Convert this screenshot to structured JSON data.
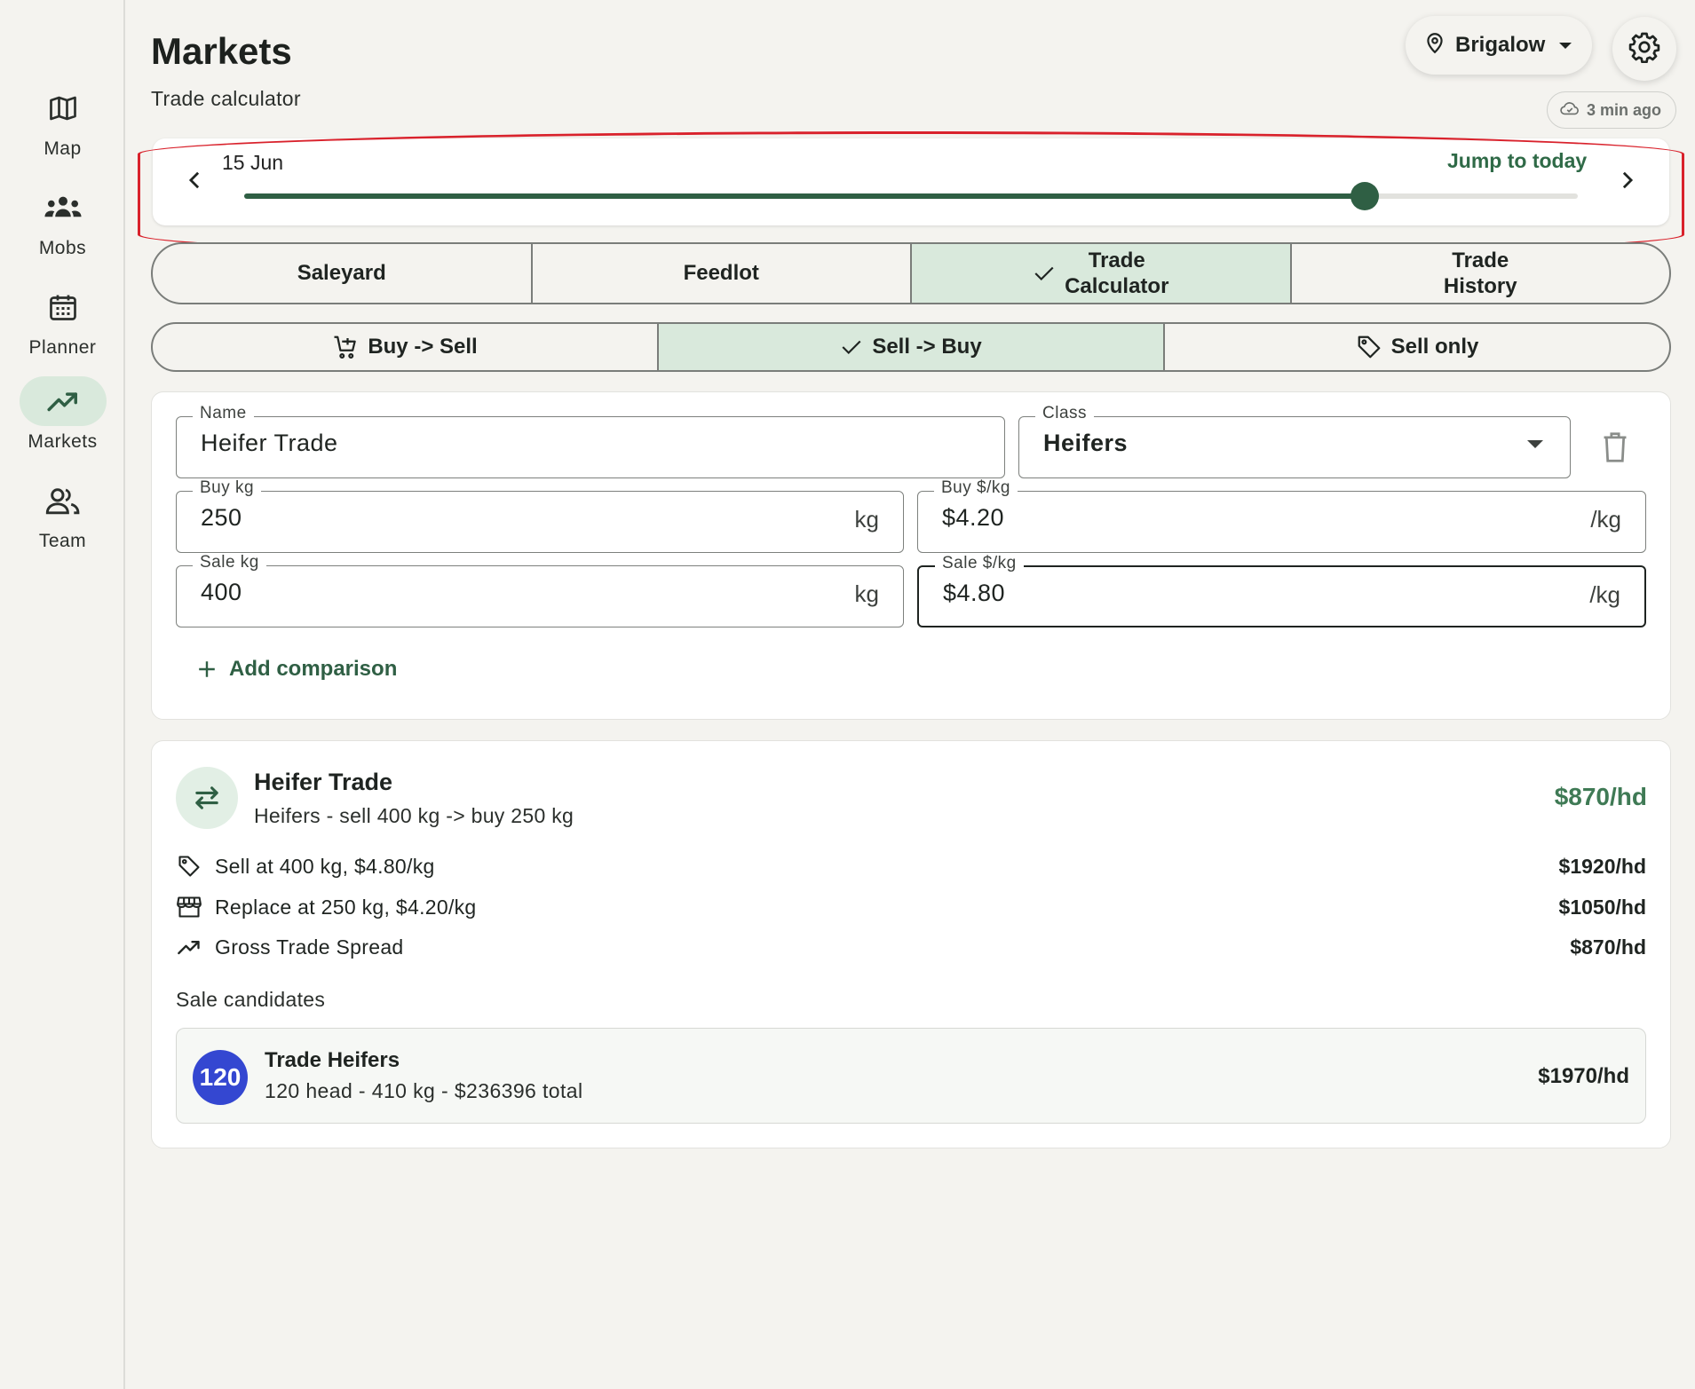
{
  "sidebar": {
    "items": [
      {
        "label": "Map",
        "icon": "map-icon"
      },
      {
        "label": "Mobs",
        "icon": "group-icon"
      },
      {
        "label": "Planner",
        "icon": "calendar-icon"
      },
      {
        "label": "Markets",
        "icon": "trending-up-icon",
        "active": true
      },
      {
        "label": "Team",
        "icon": "people-icon"
      }
    ]
  },
  "header": {
    "title": "Markets",
    "subtitle": "Trade calculator",
    "location": "Brigalow",
    "sync_status": "3 min ago"
  },
  "date_slider": {
    "date": "15 Jun",
    "jump_label": "Jump to today",
    "position": 0.84
  },
  "tabs": [
    {
      "label": "Saleyard",
      "selected": false
    },
    {
      "label": "Feedlot",
      "selected": false
    },
    {
      "label": "Trade\nCalculator",
      "selected": true
    },
    {
      "label": "Trade\nHistory",
      "selected": false
    }
  ],
  "modes": [
    {
      "label": "Buy -> Sell",
      "icon": "cart-add-icon",
      "selected": false
    },
    {
      "label": "Sell -> Buy",
      "icon": "check-icon",
      "selected": true
    },
    {
      "label": "Sell only",
      "icon": "tag-icon",
      "selected": false
    }
  ],
  "form": {
    "name_label": "Name",
    "name_value": "Heifer Trade",
    "class_label": "Class",
    "class_value": "Heifers",
    "buy_kg_label": "Buy kg",
    "buy_kg_value": "250",
    "buy_kg_suffix": "kg",
    "buy_price_label": "Buy $/kg",
    "buy_price_value": "$4.20",
    "buy_price_suffix": "/kg",
    "sale_kg_label": "Sale kg",
    "sale_kg_value": "400",
    "sale_kg_suffix": "kg",
    "sale_price_label": "Sale $/kg",
    "sale_price_value": "$4.80",
    "sale_price_suffix": "/kg",
    "add_comparison": "Add comparison"
  },
  "result": {
    "title": "Heifer Trade",
    "subtitle": "Heifers - sell 400 kg -> buy 250 kg",
    "total": "$870/hd",
    "lines": [
      {
        "text": "Sell at 400 kg, $4.80/kg",
        "amount": "$1920/hd",
        "icon": "tag-icon"
      },
      {
        "text": "Replace at 250 kg, $4.20/kg",
        "amount": "$1050/hd",
        "icon": "store-icon"
      },
      {
        "text": "Gross Trade Spread",
        "amount": "$870/hd",
        "icon": "trending-up-icon"
      }
    ],
    "candidates_label": "Sale candidates",
    "candidate": {
      "badge": "120",
      "name": "Trade Heifers",
      "detail": "120 head - 410 kg - $236396 total",
      "amount": "$1970/hd"
    }
  },
  "colors": {
    "accent": "#2f5f44",
    "selected_bg": "#d9e9dc",
    "badge": "#3447d1",
    "highlight": "#d9222c"
  }
}
